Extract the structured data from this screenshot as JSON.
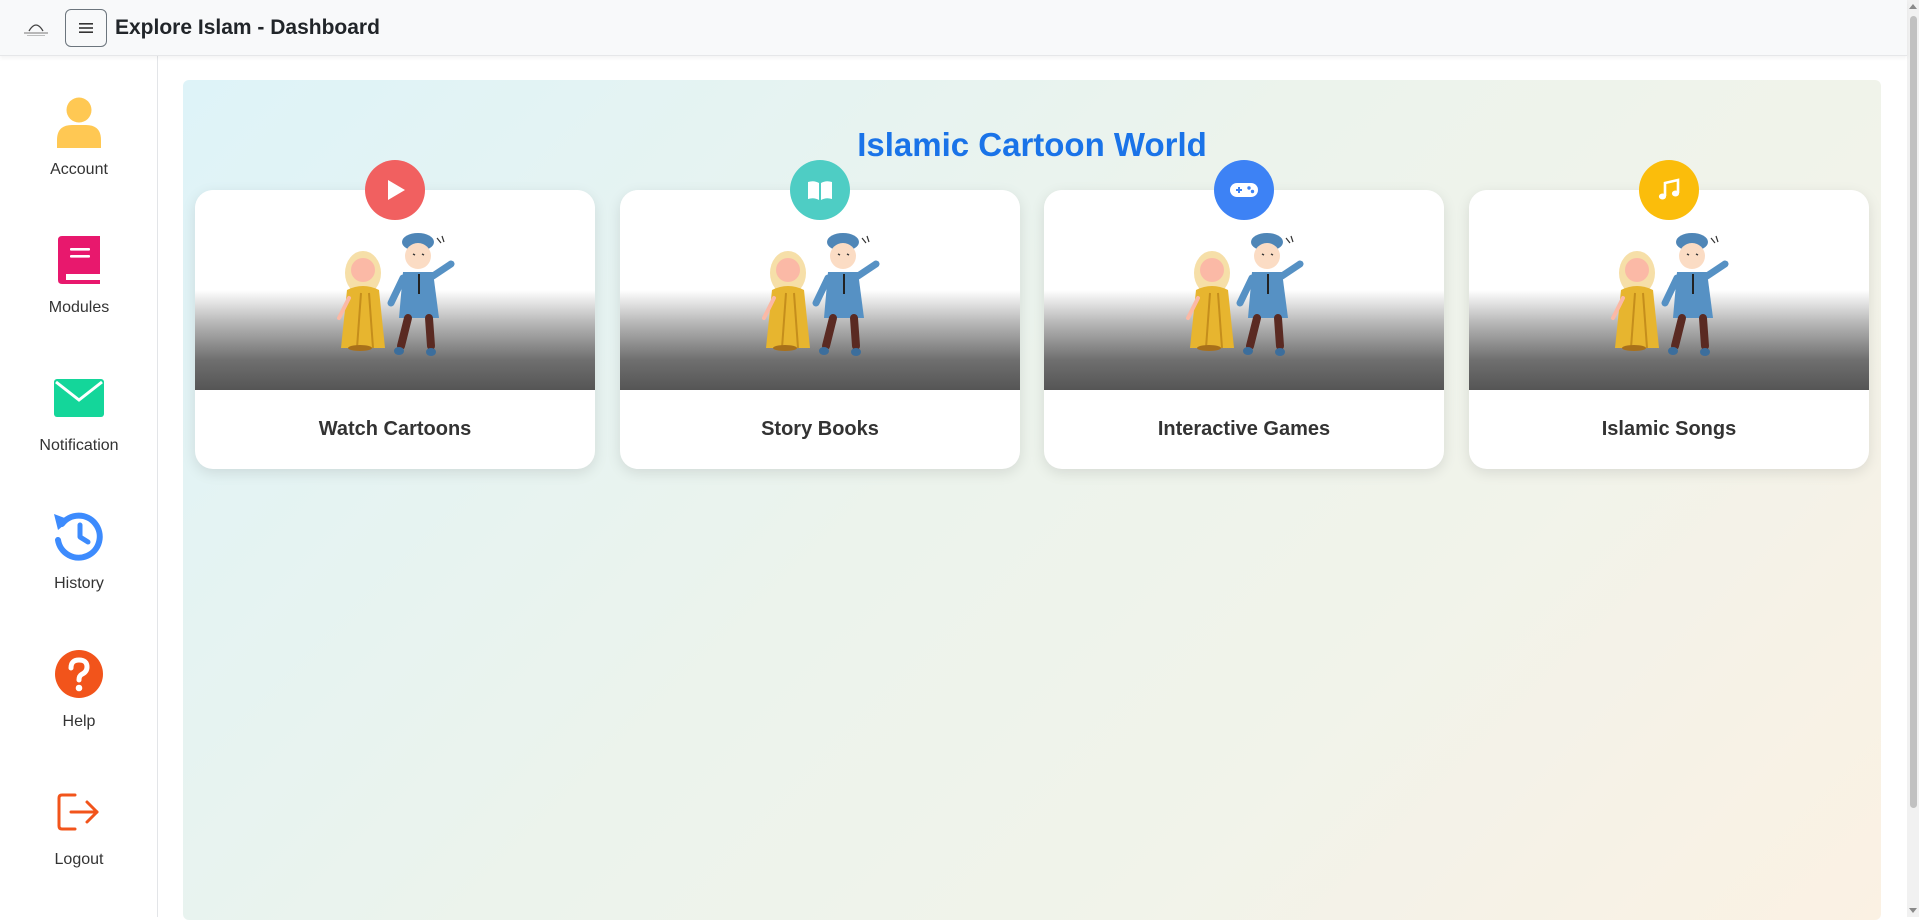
{
  "header": {
    "title": "Explore Islam - Dashboard",
    "menu_icon": "hamburger-icon",
    "logo_icon": "mosque-logo-icon"
  },
  "sidebar": {
    "items": [
      {
        "label": "Account",
        "icon": "user-icon",
        "color": "#ffc853"
      },
      {
        "label": "Modules",
        "icon": "book-icon",
        "color": "#e8186d"
      },
      {
        "label": "Notification",
        "icon": "envelope-icon",
        "color": "#14d69a"
      },
      {
        "label": "History",
        "icon": "history-icon",
        "color": "#3d8bfd"
      },
      {
        "label": "Help",
        "icon": "question-icon",
        "color": "#f2541b"
      },
      {
        "label": "Logout",
        "icon": "logout-icon",
        "color": "#f2541b"
      }
    ]
  },
  "main": {
    "title": "Islamic Cartoon World",
    "title_color": "#1a73e8",
    "cards": [
      {
        "label": "Watch Cartoons",
        "badge_icon": "play-icon",
        "badge_color": "#f16060"
      },
      {
        "label": "Story Books",
        "badge_icon": "book-open-icon",
        "badge_color": "#4ecdc4"
      },
      {
        "label": "Interactive Games",
        "badge_icon": "gamepad-icon",
        "badge_color": "#3d82f5"
      },
      {
        "label": "Islamic Songs",
        "badge_icon": "music-icon",
        "badge_color": "#fbbd0b"
      }
    ]
  }
}
